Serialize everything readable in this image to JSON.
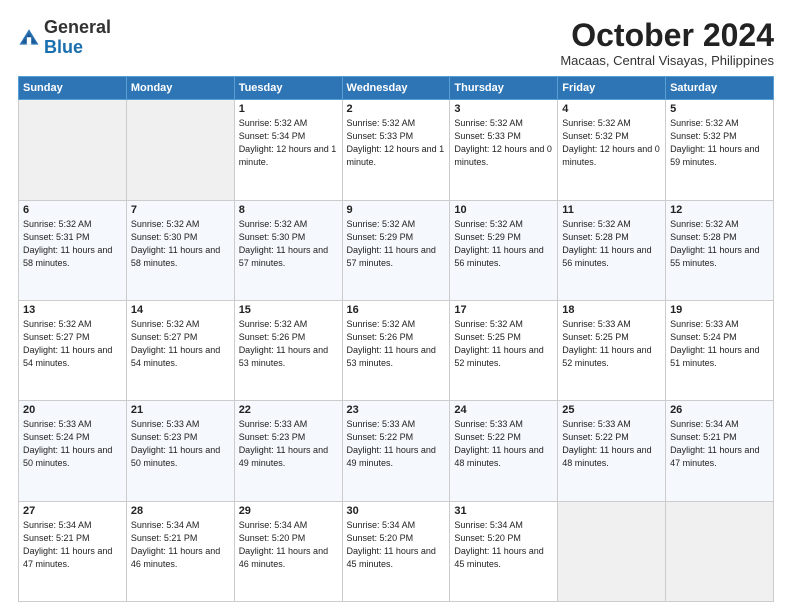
{
  "header": {
    "logo_general": "General",
    "logo_blue": "Blue",
    "month_title": "October 2024",
    "location": "Macaas, Central Visayas, Philippines"
  },
  "weekdays": [
    "Sunday",
    "Monday",
    "Tuesday",
    "Wednesday",
    "Thursday",
    "Friday",
    "Saturday"
  ],
  "weeks": [
    [
      {
        "day": "",
        "sunrise": "",
        "sunset": "",
        "daylight": ""
      },
      {
        "day": "",
        "sunrise": "",
        "sunset": "",
        "daylight": ""
      },
      {
        "day": "1",
        "sunrise": "Sunrise: 5:32 AM",
        "sunset": "Sunset: 5:34 PM",
        "daylight": "Daylight: 12 hours and 1 minute."
      },
      {
        "day": "2",
        "sunrise": "Sunrise: 5:32 AM",
        "sunset": "Sunset: 5:33 PM",
        "daylight": "Daylight: 12 hours and 1 minute."
      },
      {
        "day": "3",
        "sunrise": "Sunrise: 5:32 AM",
        "sunset": "Sunset: 5:33 PM",
        "daylight": "Daylight: 12 hours and 0 minutes."
      },
      {
        "day": "4",
        "sunrise": "Sunrise: 5:32 AM",
        "sunset": "Sunset: 5:32 PM",
        "daylight": "Daylight: 12 hours and 0 minutes."
      },
      {
        "day": "5",
        "sunrise": "Sunrise: 5:32 AM",
        "sunset": "Sunset: 5:32 PM",
        "daylight": "Daylight: 11 hours and 59 minutes."
      }
    ],
    [
      {
        "day": "6",
        "sunrise": "Sunrise: 5:32 AM",
        "sunset": "Sunset: 5:31 PM",
        "daylight": "Daylight: 11 hours and 58 minutes."
      },
      {
        "day": "7",
        "sunrise": "Sunrise: 5:32 AM",
        "sunset": "Sunset: 5:30 PM",
        "daylight": "Daylight: 11 hours and 58 minutes."
      },
      {
        "day": "8",
        "sunrise": "Sunrise: 5:32 AM",
        "sunset": "Sunset: 5:30 PM",
        "daylight": "Daylight: 11 hours and 57 minutes."
      },
      {
        "day": "9",
        "sunrise": "Sunrise: 5:32 AM",
        "sunset": "Sunset: 5:29 PM",
        "daylight": "Daylight: 11 hours and 57 minutes."
      },
      {
        "day": "10",
        "sunrise": "Sunrise: 5:32 AM",
        "sunset": "Sunset: 5:29 PM",
        "daylight": "Daylight: 11 hours and 56 minutes."
      },
      {
        "day": "11",
        "sunrise": "Sunrise: 5:32 AM",
        "sunset": "Sunset: 5:28 PM",
        "daylight": "Daylight: 11 hours and 56 minutes."
      },
      {
        "day": "12",
        "sunrise": "Sunrise: 5:32 AM",
        "sunset": "Sunset: 5:28 PM",
        "daylight": "Daylight: 11 hours and 55 minutes."
      }
    ],
    [
      {
        "day": "13",
        "sunrise": "Sunrise: 5:32 AM",
        "sunset": "Sunset: 5:27 PM",
        "daylight": "Daylight: 11 hours and 54 minutes."
      },
      {
        "day": "14",
        "sunrise": "Sunrise: 5:32 AM",
        "sunset": "Sunset: 5:27 PM",
        "daylight": "Daylight: 11 hours and 54 minutes."
      },
      {
        "day": "15",
        "sunrise": "Sunrise: 5:32 AM",
        "sunset": "Sunset: 5:26 PM",
        "daylight": "Daylight: 11 hours and 53 minutes."
      },
      {
        "day": "16",
        "sunrise": "Sunrise: 5:32 AM",
        "sunset": "Sunset: 5:26 PM",
        "daylight": "Daylight: 11 hours and 53 minutes."
      },
      {
        "day": "17",
        "sunrise": "Sunrise: 5:32 AM",
        "sunset": "Sunset: 5:25 PM",
        "daylight": "Daylight: 11 hours and 52 minutes."
      },
      {
        "day": "18",
        "sunrise": "Sunrise: 5:33 AM",
        "sunset": "Sunset: 5:25 PM",
        "daylight": "Daylight: 11 hours and 52 minutes."
      },
      {
        "day": "19",
        "sunrise": "Sunrise: 5:33 AM",
        "sunset": "Sunset: 5:24 PM",
        "daylight": "Daylight: 11 hours and 51 minutes."
      }
    ],
    [
      {
        "day": "20",
        "sunrise": "Sunrise: 5:33 AM",
        "sunset": "Sunset: 5:24 PM",
        "daylight": "Daylight: 11 hours and 50 minutes."
      },
      {
        "day": "21",
        "sunrise": "Sunrise: 5:33 AM",
        "sunset": "Sunset: 5:23 PM",
        "daylight": "Daylight: 11 hours and 50 minutes."
      },
      {
        "day": "22",
        "sunrise": "Sunrise: 5:33 AM",
        "sunset": "Sunset: 5:23 PM",
        "daylight": "Daylight: 11 hours and 49 minutes."
      },
      {
        "day": "23",
        "sunrise": "Sunrise: 5:33 AM",
        "sunset": "Sunset: 5:22 PM",
        "daylight": "Daylight: 11 hours and 49 minutes."
      },
      {
        "day": "24",
        "sunrise": "Sunrise: 5:33 AM",
        "sunset": "Sunset: 5:22 PM",
        "daylight": "Daylight: 11 hours and 48 minutes."
      },
      {
        "day": "25",
        "sunrise": "Sunrise: 5:33 AM",
        "sunset": "Sunset: 5:22 PM",
        "daylight": "Daylight: 11 hours and 48 minutes."
      },
      {
        "day": "26",
        "sunrise": "Sunrise: 5:34 AM",
        "sunset": "Sunset: 5:21 PM",
        "daylight": "Daylight: 11 hours and 47 minutes."
      }
    ],
    [
      {
        "day": "27",
        "sunrise": "Sunrise: 5:34 AM",
        "sunset": "Sunset: 5:21 PM",
        "daylight": "Daylight: 11 hours and 47 minutes."
      },
      {
        "day": "28",
        "sunrise": "Sunrise: 5:34 AM",
        "sunset": "Sunset: 5:21 PM",
        "daylight": "Daylight: 11 hours and 46 minutes."
      },
      {
        "day": "29",
        "sunrise": "Sunrise: 5:34 AM",
        "sunset": "Sunset: 5:20 PM",
        "daylight": "Daylight: 11 hours and 46 minutes."
      },
      {
        "day": "30",
        "sunrise": "Sunrise: 5:34 AM",
        "sunset": "Sunset: 5:20 PM",
        "daylight": "Daylight: 11 hours and 45 minutes."
      },
      {
        "day": "31",
        "sunrise": "Sunrise: 5:34 AM",
        "sunset": "Sunset: 5:20 PM",
        "daylight": "Daylight: 11 hours and 45 minutes."
      },
      {
        "day": "",
        "sunrise": "",
        "sunset": "",
        "daylight": ""
      },
      {
        "day": "",
        "sunrise": "",
        "sunset": "",
        "daylight": ""
      }
    ]
  ]
}
